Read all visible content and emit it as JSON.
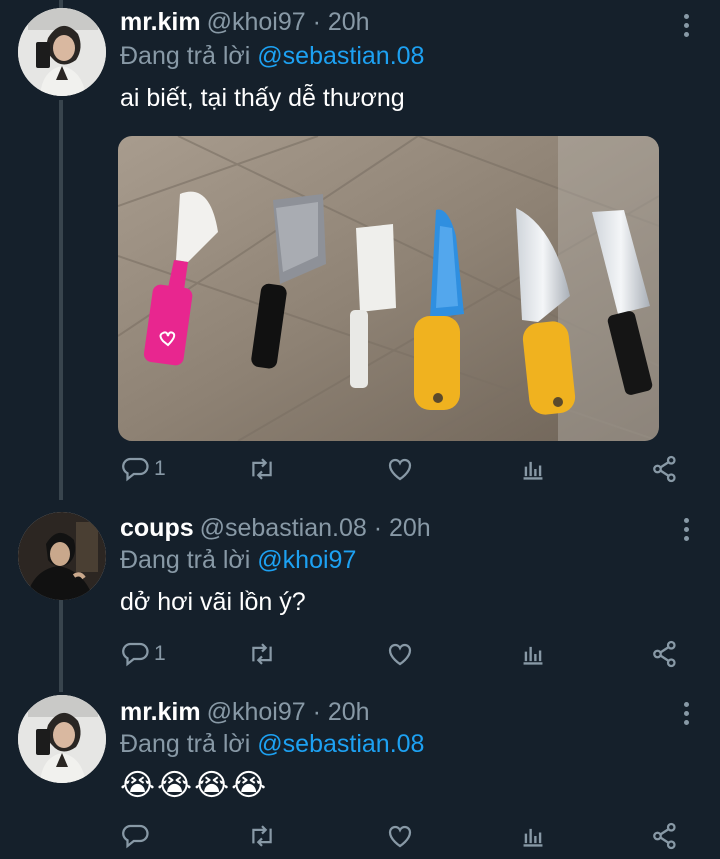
{
  "tweets": [
    {
      "name": "mr.kim",
      "handle": "@khoi97 · 20h",
      "reply_prefix": "Đang trả lời",
      "reply_to": "@sebastian.08",
      "text": "ai biết, tại thấy dễ thương",
      "replies": "1",
      "has_media": true
    },
    {
      "name": "coups",
      "handle": "@sebastian.08 · 20h",
      "reply_prefix": "Đang trả lời",
      "reply_to": "@khoi97",
      "text": "dở hơi vãi lồn ý?",
      "replies": "1"
    },
    {
      "name": "mr.kim",
      "handle": "@khoi97 · 20h",
      "reply_prefix": "Đang trả lời",
      "reply_to": "@sebastian.08",
      "text": "😭😭😭😭",
      "replies": ""
    }
  ],
  "icons": {
    "reply": "reply-icon",
    "retweet": "retweet-icon",
    "like": "like-icon",
    "stats": "stats-icon",
    "share": "share-icon",
    "more": "more-options-icon"
  },
  "colors": {
    "background": "#15202b",
    "secondary_text": "#8899a6",
    "mention": "#1da1f2",
    "thread_line": "#38444d"
  }
}
